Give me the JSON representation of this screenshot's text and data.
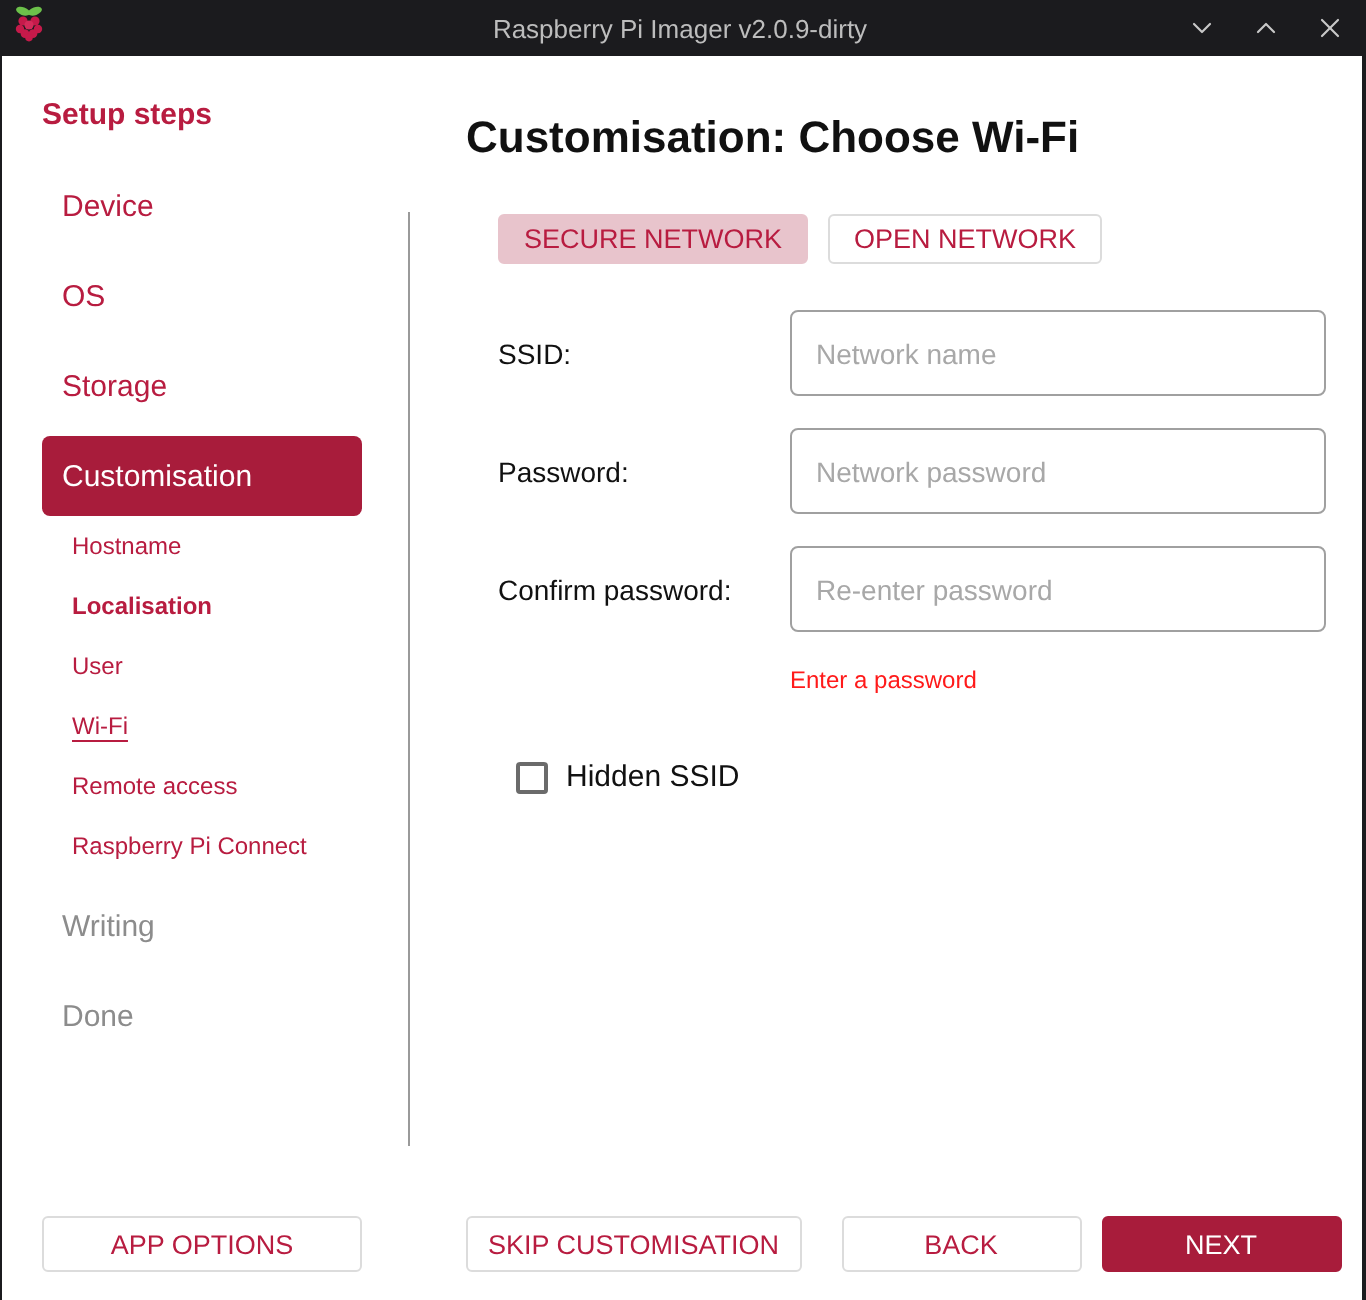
{
  "window": {
    "title": "Raspberry Pi Imager v2.0.9-dirty"
  },
  "sidebar": {
    "title": "Setup steps",
    "items": [
      {
        "label": "Device",
        "selected": false,
        "disabled": false
      },
      {
        "label": "OS",
        "selected": false,
        "disabled": false
      },
      {
        "label": "Storage",
        "selected": false,
        "disabled": false
      },
      {
        "label": "Customisation",
        "selected": true,
        "disabled": false,
        "children": [
          {
            "label": "Hostname",
            "selected": false,
            "emphasized": false
          },
          {
            "label": "Localisation",
            "selected": false,
            "emphasized": true
          },
          {
            "label": "User",
            "selected": false,
            "emphasized": false
          },
          {
            "label": "Wi-Fi",
            "selected": true,
            "emphasized": false
          },
          {
            "label": "Remote access",
            "selected": false,
            "emphasized": false
          },
          {
            "label": "Raspberry Pi Connect",
            "selected": false,
            "emphasized": false
          }
        ]
      },
      {
        "label": "Writing",
        "selected": false,
        "disabled": true
      },
      {
        "label": "Done",
        "selected": false,
        "disabled": true
      }
    ],
    "button": {
      "label": "APP OPTIONS",
      "kind": "secondary"
    }
  },
  "main": {
    "heading": "Customisation: Choose Wi-Fi",
    "tabs": [
      {
        "label": "SECURE NETWORK",
        "selected": true
      },
      {
        "label": "OPEN NETWORK",
        "selected": false
      }
    ],
    "fields": [
      {
        "label": "SSID:",
        "placeholder": "Network name"
      },
      {
        "label": "Password:",
        "placeholder": "Network password"
      },
      {
        "label": "Confirm password:",
        "placeholder": "Re-enter password"
      }
    ],
    "error": "Enter a password",
    "hidden_ssid": {
      "label": "Hidden SSID",
      "checked": false
    },
    "buttons": [
      {
        "label": "SKIP CUSTOMISATION",
        "kind": "secondary"
      },
      {
        "label": "BACK",
        "kind": "secondary"
      },
      {
        "label": "NEXT",
        "kind": "primary"
      }
    ]
  }
}
